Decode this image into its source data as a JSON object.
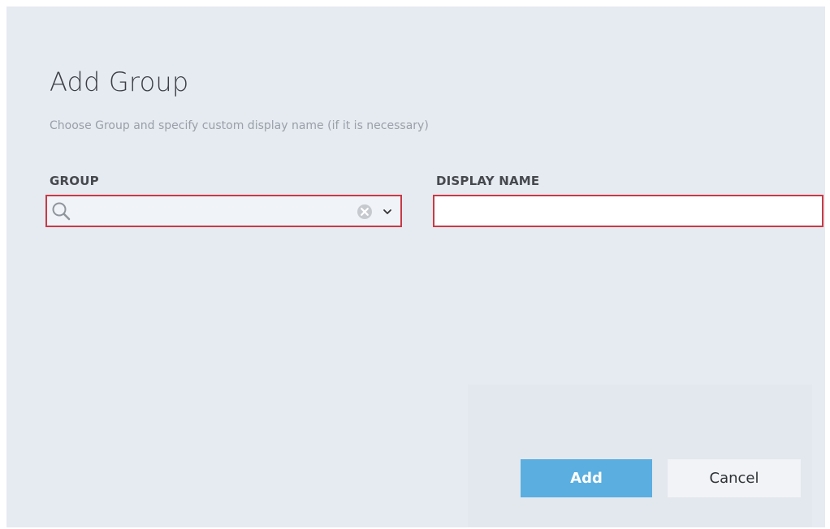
{
  "dialog": {
    "title": "Add Group",
    "subtitle": "Choose Group and specify custom display name (if it is necessary)"
  },
  "fields": {
    "group": {
      "label": "GROUP",
      "value": "",
      "placeholder": "",
      "icons": [
        "search-icon",
        "clear-icon",
        "chevron-down-icon"
      ]
    },
    "display_name": {
      "label": "DISPLAY NAME",
      "value": "",
      "placeholder": ""
    }
  },
  "buttons": {
    "add_label": "Add",
    "cancel_label": "Cancel"
  },
  "colors": {
    "background": "#e6eaf1",
    "error_border": "#c83a46",
    "primary_button": "#5aaee0",
    "secondary_button": "#f1f3f6"
  }
}
